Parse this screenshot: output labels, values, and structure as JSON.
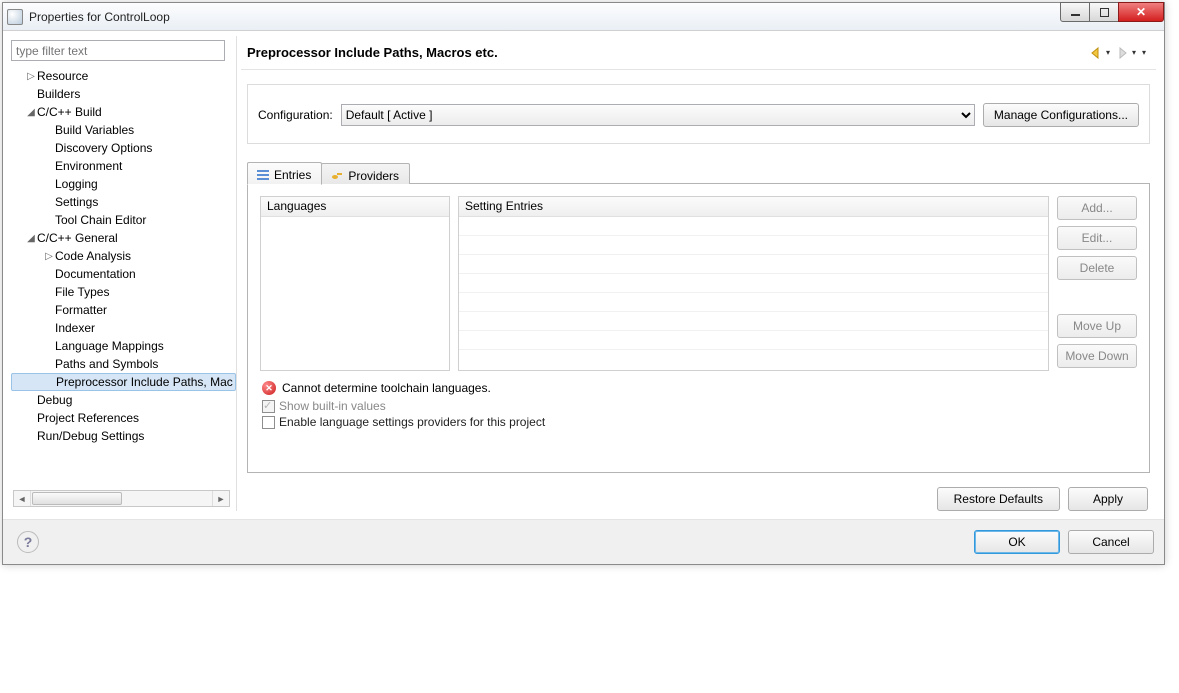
{
  "window": {
    "title": "Properties for ControlLoop"
  },
  "filter": {
    "placeholder": "type filter text"
  },
  "tree": {
    "items": [
      {
        "label": "Resource",
        "indent": 0,
        "twist": "▷"
      },
      {
        "label": "Builders",
        "indent": 0,
        "twist": ""
      },
      {
        "label": "C/C++ Build",
        "indent": 0,
        "twist": "◢"
      },
      {
        "label": "Build Variables",
        "indent": 1,
        "twist": ""
      },
      {
        "label": "Discovery Options",
        "indent": 1,
        "twist": ""
      },
      {
        "label": "Environment",
        "indent": 1,
        "twist": ""
      },
      {
        "label": "Logging",
        "indent": 1,
        "twist": ""
      },
      {
        "label": "Settings",
        "indent": 1,
        "twist": ""
      },
      {
        "label": "Tool Chain Editor",
        "indent": 1,
        "twist": ""
      },
      {
        "label": "C/C++ General",
        "indent": 0,
        "twist": "◢"
      },
      {
        "label": "Code Analysis",
        "indent": 1,
        "twist": "▷"
      },
      {
        "label": "Documentation",
        "indent": 1,
        "twist": ""
      },
      {
        "label": "File Types",
        "indent": 1,
        "twist": ""
      },
      {
        "label": "Formatter",
        "indent": 1,
        "twist": ""
      },
      {
        "label": "Indexer",
        "indent": 1,
        "twist": ""
      },
      {
        "label": "Language Mappings",
        "indent": 1,
        "twist": ""
      },
      {
        "label": "Paths and Symbols",
        "indent": 1,
        "twist": ""
      },
      {
        "label": "Preprocessor Include Paths, Mac",
        "indent": 1,
        "twist": "",
        "selected": true
      },
      {
        "label": "Debug",
        "indent": 0,
        "twist": ""
      },
      {
        "label": "Project References",
        "indent": 0,
        "twist": ""
      },
      {
        "label": "Run/Debug Settings",
        "indent": 0,
        "twist": ""
      }
    ]
  },
  "page": {
    "title": "Preprocessor Include Paths, Macros etc.",
    "config_label": "Configuration:",
    "config_value": "Default  [ Active ]",
    "manage_btn": "Manage Configurations...",
    "tabs": {
      "entries": "Entries",
      "providers": "Providers"
    },
    "lang_header": "Languages",
    "entries_header": "Setting Entries",
    "buttons": {
      "add": "Add...",
      "edit": "Edit...",
      "delete": "Delete",
      "moveup": "Move Up",
      "movedown": "Move Down",
      "restore": "Restore Defaults",
      "apply": "Apply"
    },
    "error": "Cannot determine toolchain languages.",
    "show_builtin": "Show built-in values",
    "enable_providers": "Enable language settings providers for this project"
  },
  "footer": {
    "ok": "OK",
    "cancel": "Cancel"
  }
}
